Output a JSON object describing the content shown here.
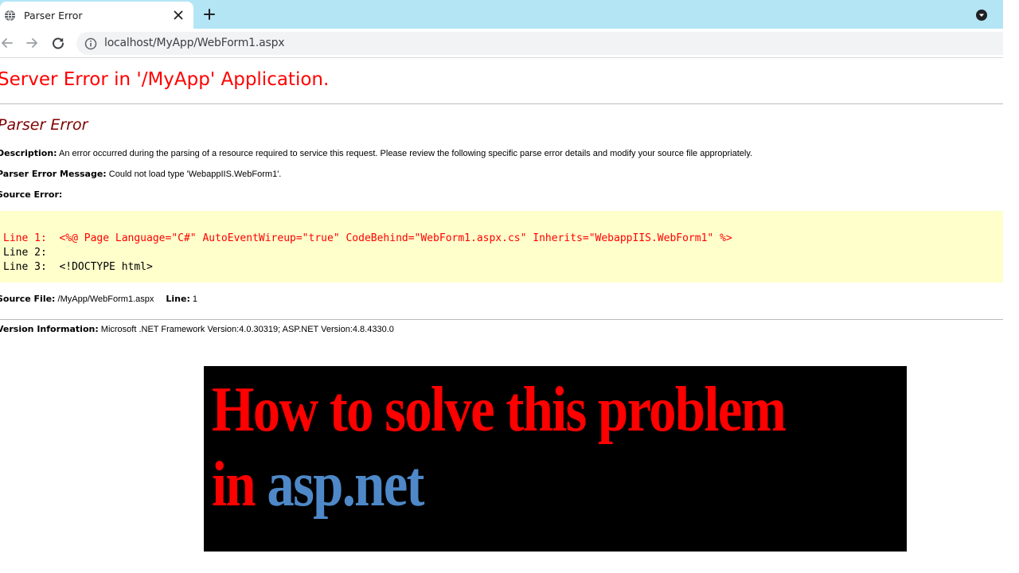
{
  "browser": {
    "tab_title": "Parser Error",
    "url": "localhost/MyApp/WebForm1.aspx"
  },
  "page": {
    "app_title": "Server Error in '/MyApp' Application.",
    "error_type": "Parser Error",
    "description_label": "Description:",
    "description_text": " An error occurred during the parsing of a resource required to service this request. Please review the following specific parse error details and modify your source file appropriately.",
    "message_label": "Parser Error Message:",
    "message_text": " Could not load type 'WebappIIS.WebForm1'.",
    "source_error_label": "Source Error:",
    "code_lines": [
      "Line 1:  <%@ Page Language=\"C#\" AutoEventWireup=\"true\" CodeBehind=\"WebForm1.aspx.cs\" Inherits=\"WebappIIS.WebForm1\" %>",
      "Line 2:",
      "Line 3:  <!DOCTYPE html>"
    ],
    "source_file_label": "Source File:",
    "source_file_value": " /MyApp/WebForm1.aspx",
    "line_label": "Line:",
    "line_value": " 1",
    "version_label": "Version Information:",
    "version_text": " Microsoft .NET Framework Version:4.0.30319; ASP.NET Version:4.8.4330.0"
  },
  "banner": {
    "line1": "How to solve this problem",
    "line2_prefix": "in ",
    "line2_accent": "asp.net",
    "colors": {
      "text": "#ff0000",
      "accent": "#4e88c8",
      "background": "#000000"
    }
  },
  "icons": [
    "globe-icon",
    "close-icon",
    "plus-icon",
    "dropdown-icon",
    "back-arrow-icon",
    "forward-arrow-icon",
    "reload-icon",
    "info-icon"
  ]
}
